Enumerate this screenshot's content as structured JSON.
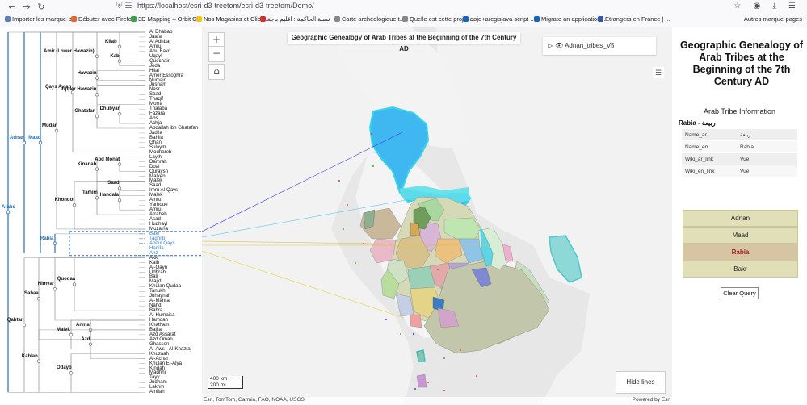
{
  "browser": {
    "url": "https://localhost/esri-d3-treetom/esri-d3-treetom/Demo/",
    "bookmarks": [
      {
        "label": "Importer les marque-p...",
        "color": "#5a7fb8"
      },
      {
        "label": "Débuter avec Firefox",
        "color": "#e8662e"
      },
      {
        "label": "3D Mapping – Orbit GT",
        "color": "#3aa04a"
      },
      {
        "label": "Nos Magasins et Click...",
        "color": "#f2c318"
      },
      {
        "label": "نسبة الحاكمة : اقليم باجة",
        "color": "#d32f2f"
      },
      {
        "label": "Carte archéologique t...",
        "color": "#888888"
      },
      {
        "label": "Quelle est cette projec...",
        "color": "#888888"
      },
      {
        "label": "dojo+arcgisjava script ...",
        "color": "#1565c0"
      },
      {
        "label": "Migrate an application...",
        "color": "#1565c0"
      },
      {
        "label": "Etrangers en France | ...",
        "color": "#3355aa"
      }
    ],
    "other_bookmarks": "Autres marque-pages"
  },
  "tree": {
    "leaves": [
      "Al Dhabab",
      "Jaafar",
      "Al Adhbat",
      "Amru",
      "Abu Bakr",
      "Uqayl",
      "Quochair",
      "Jeda",
      "Hilal",
      "Amer Essoghra",
      "Numair",
      "Jusham",
      "Nasr",
      "Saad",
      "Thaqif",
      "Morra",
      "Thalaba",
      "Fazara",
      "Abs",
      "Achja",
      "Abdallah ibn Ghatafan",
      "Jadila",
      "Bahila",
      "Ghani",
      "Sulaym",
      "Mouhareb",
      "Layth",
      "Damrah",
      "Doal",
      "Quraysh",
      "Malken",
      "Malek",
      "Saad",
      "Imru Al-Qays",
      "Malek",
      "Amru",
      "Yarboue",
      "Amru",
      "Arrabeb",
      "Asad",
      "Hudhayl",
      "Muzaina",
      "Bakr",
      "Taghlib",
      "Abdul Qays",
      "Hanifa",
      "Anz",
      "Akk",
      "Kalb",
      "Al-Qayn",
      "Udhrah",
      "Bali",
      "Majid",
      "Khulan Qudaa",
      "Tanukh",
      "Juhaynah",
      "Al-Mahra",
      "Nahd",
      "Bahra",
      "Al-Humaisa",
      "Hamdan",
      "Khatham",
      "Bajila",
      "Azd Assarat",
      "Azd Oman",
      "Ghassen",
      "Al-Aws - Al-Khazraj",
      "Khuzaah",
      "Al-Achar",
      "Khulan El-Alya",
      "Kindah",
      "Madhhij",
      "Tayy",
      "Judham",
      "Lakhm",
      "Amilah"
    ],
    "nodes": [
      {
        "label": "Kilab"
      },
      {
        "label": "Kab"
      },
      {
        "label": "Amir (Lower Hawazin)"
      },
      {
        "label": "Hawazin"
      },
      {
        "label": "Upper Hawazin"
      },
      {
        "label": "Dhubyan"
      },
      {
        "label": "Ghatafan"
      },
      {
        "label": "Qays Aylan"
      },
      {
        "label": "Abd Monat"
      },
      {
        "label": "Kinanah"
      },
      {
        "label": "Mudar"
      },
      {
        "label": "Saad"
      },
      {
        "label": "Handala"
      },
      {
        "label": "Tamim"
      },
      {
        "label": "Khondof"
      },
      {
        "label": "Maad"
      },
      {
        "label": "Adnan"
      },
      {
        "label": "Rabia"
      },
      {
        "label": "Arabs"
      },
      {
        "label": "Quodaa"
      },
      {
        "label": "Himyar"
      },
      {
        "label": "Sabaa"
      },
      {
        "label": "Qahtan"
      },
      {
        "label": "Malek"
      },
      {
        "label": "Anmar"
      },
      {
        "label": "Azd"
      },
      {
        "label": "Kahlan"
      },
      {
        "label": "Odayb"
      }
    ],
    "highlighted_leaves": [
      "Bakr",
      "Taghlib",
      "Abdul Qays",
      "Hanifa",
      "Anz"
    ]
  },
  "map": {
    "title": "Geographic Genealogy of Arab Tribes at the Beginning of the 7th Century AD",
    "layer_name": "Adnan_tribes_V5",
    "zoom_in": "+",
    "zoom_out": "−",
    "home": "⌂",
    "scale_km": "400 km",
    "scale_mi": "200 mi",
    "hide_lines_label": "Hide lines",
    "attribution": "Esri, TomTom, Garmin, FAO, NOAA, USGS",
    "powered_by": "Powered by Esri",
    "colors": {
      "tribe_highlight": "#39b6f0",
      "land": "#f2f2f2",
      "water": "#e7e7e7"
    }
  },
  "panel": {
    "title": "Geographic Genealogy of Arab Tribes at the Beginning of the 7th Century AD",
    "subtitle": "Arab Tribe Information",
    "selected_heading": "Rabia - ربيعة",
    "attributes": [
      {
        "key": "Name_ar",
        "value": "ربيعة"
      },
      {
        "key": "Name_en",
        "value": "Rabia"
      },
      {
        "key": "Wiki_ar_link",
        "value": "Vue"
      },
      {
        "key": "Wiki_en_link",
        "value": "Vue"
      }
    ],
    "lineage_buttons": [
      {
        "label": "Adnan",
        "selected": false
      },
      {
        "label": "Maad",
        "selected": false
      },
      {
        "label": "Rabia",
        "selected": true
      },
      {
        "label": "Bakr",
        "selected": false
      }
    ],
    "clear_query_label": "Clear Query"
  }
}
